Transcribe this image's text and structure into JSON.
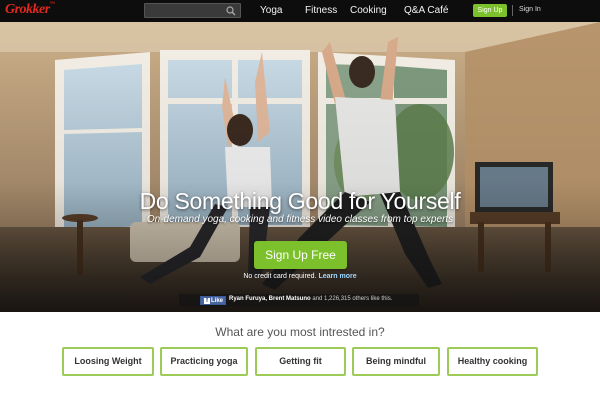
{
  "header": {
    "logo": "Grokker",
    "logo_tm": "™",
    "search": {
      "placeholder": ""
    },
    "nav": [
      "Yoga",
      "Fitness",
      "Cooking",
      "Q&A Café"
    ],
    "signup_label": "Sign Up",
    "signin_label": "Sign In"
  },
  "hero": {
    "title": "Do Something Good for Yourself",
    "subtitle": "On-demand yoga, cooking and fitness video classes from top experts",
    "cta_label": "Sign Up Free",
    "no_credit_text": "No credit card required.",
    "learn_more": "Learn more",
    "facebook": {
      "like_label": "Like",
      "names": "Ryan Furuya, Brent Matsuno",
      "others": "and 1,226,315 others like this."
    }
  },
  "interests": {
    "title": "What are you most intrested in?",
    "options": [
      "Loosing Weight",
      "Practicing yoga",
      "Getting fit",
      "Being mindful",
      "Healthy cooking"
    ]
  },
  "colors": {
    "brand_red": "#e1281f",
    "accent_green": "#7cc02b",
    "nav_bg": "#0d0d0d",
    "option_border": "#9dcb57"
  }
}
